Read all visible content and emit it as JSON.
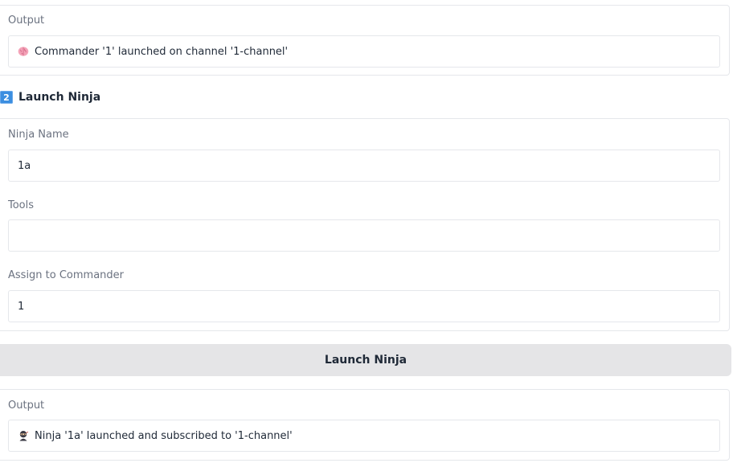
{
  "commander_output": {
    "label": "Output",
    "icon": "brain-icon",
    "text": "Commander '1' launched on channel '1-channel'"
  },
  "launch_ninja": {
    "step_icon": "keycap-2-icon",
    "step_number": "2",
    "heading": "Launch Ninja",
    "ninja_name": {
      "label": "Ninja Name",
      "value": "1a"
    },
    "tools": {
      "label": "Tools",
      "value": ""
    },
    "assign_commander": {
      "label": "Assign to Commander",
      "value": "1"
    },
    "button_label": "Launch Ninja"
  },
  "ninja_output": {
    "label": "Output",
    "icon": "ninja-icon",
    "text": "Ninja '1a' launched and subscribed to '1-channel'"
  },
  "colors": {
    "button_bg": "#e5e5e7",
    "border": "#e5e7eb",
    "label_text": "#6b7280",
    "keycap_blue": "#3b8ee0"
  }
}
